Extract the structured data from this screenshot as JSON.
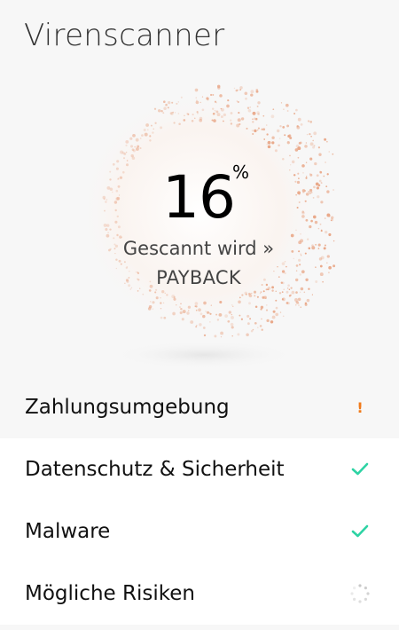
{
  "header": {
    "title": "Virenscanner"
  },
  "scan": {
    "progress_value": "16",
    "progress_percent": 16,
    "percent_sign": "%",
    "status_label": "Gescannt wird »",
    "current_target": "PAYBACK"
  },
  "checks": [
    {
      "label": "Zahlungsumgebung",
      "status": "warning",
      "status_icon": "exclamation-icon",
      "status_glyph": "!"
    },
    {
      "label": "Datenschutz & Sicherheit",
      "status": "done",
      "status_icon": "checkmark-icon"
    },
    {
      "label": "Malware",
      "status": "done",
      "status_icon": "checkmark-icon"
    },
    {
      "label": "Mögliche Risiken",
      "status": "in-progress",
      "status_icon": "spinner-icon"
    }
  ],
  "colors": {
    "accent_check": "#2ed3a4",
    "warning": "#f07a1a",
    "particles": "#e9a98a"
  }
}
